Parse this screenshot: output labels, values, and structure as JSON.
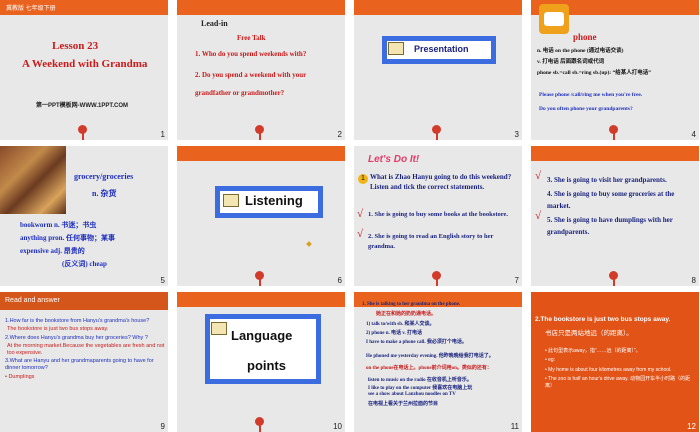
{
  "slides": [
    {
      "num": "1",
      "header": "冀教版  七年级下册",
      "title1": "Lesson 23",
      "title2": "A Weekend with Grandma",
      "footer": "第一PPT模板网-WWW.1PPT.COM"
    },
    {
      "num": "2",
      "lead": "Lead-in",
      "free": "Free Talk",
      "q1": "1. Who do you spend weekends with?",
      "q2": "2. Do you spend a weekend with your grandfather or grandmother?"
    },
    {
      "num": "3",
      "label": "Presentation"
    },
    {
      "num": "4",
      "word": "phone",
      "l1": "n.  电话       on the phone  (通过电话交谈)",
      "l2": "v.   打电话    后面跟名词或代词",
      "l3": "phone sb.=call sb.=ring sb.(up): “给某人打电话”",
      "l4": "Please phone /call/ring me when you're free.",
      "l5": "Do you often phone your grandparents?"
    },
    {
      "num": "5",
      "w1": "grocery/groceries",
      "w1b": "n. 杂货",
      "w2": "bookworm  n.     书迷；书虫",
      "w3": "anything   pron.  任何事物；某事",
      "w4": "expensive   adj.   昂贵的",
      "w5": "(反义词)  cheap"
    },
    {
      "num": "6",
      "label": "Listening"
    },
    {
      "num": "7",
      "banner": "Let's Do It!",
      "q": "What is Zhao Hanyu going to do this weekend? Listen and tick the correct statements.",
      "o1": "1. She is going to buy some books at the bookstore.",
      "o2": "2. She is going to read an English story to her grandma."
    },
    {
      "num": "8",
      "o3": "3. She is going to visit her grandparents.",
      "o4": "4. She is going to buy some groceries at the market.",
      "o5": "5. She is going to have dumplings with her grandparents."
    },
    {
      "num": "9",
      "title": "Read and answer",
      "q1": "1.How far is the bookstore from  Hanyu's   grandma's house?",
      "a1": "The bookstore is just two bus stops away.",
      "q2": "2.Where does  Hanyu's grandma buy her groceries? Why ?",
      "a2": "At the morning market.Because the         vegetables are fresh and not too expensive.",
      "q3": "3.What are Hanyu and her grandmaparents going to have for dinner tomorrow?",
      "a3": "• Dumplings"
    },
    {
      "num": "10",
      "label1": "Language",
      "label2": "points"
    },
    {
      "num": "11",
      "l1": "1. She is talking to her grandma on the phone.",
      "l1b": "她正在和她的奶奶通电话。",
      "l2": "1) talk to/with sb.  和某人交谈。",
      "l3": "2) phone n. 电话 v. 打电话",
      "l4": "I have to make a phone call. 我必须打个电话。",
      "l5": "He phoned me yesterday evening. 他昨晚晚给我打电话了。",
      "l6": "on the phone在电话上。phone前介词用on。类似的还有：",
      "l7": "listen to music on the radio 在收音机上听音乐。",
      "l8": "I like to play on the computer 我喜欢在电脑上玩",
      "l9": "see a show about Lanzhou noodles on TV",
      "l10": "在电视上看关于兰州拉面的节目"
    },
    {
      "num": "12",
      "title": "2.The bookstore is just two bus stops away.",
      "sub": "书店只是两站地远（的距离）。",
      "b1": "• 此句型表示away，指“……远（的距离）”。",
      "b2": "• eg:",
      "b3": "• My home is about four kilometres away from my school.",
      "b4": "• The zoo is half an hour's drive away. 动物园开车半小时路（的距离）"
    }
  ]
}
